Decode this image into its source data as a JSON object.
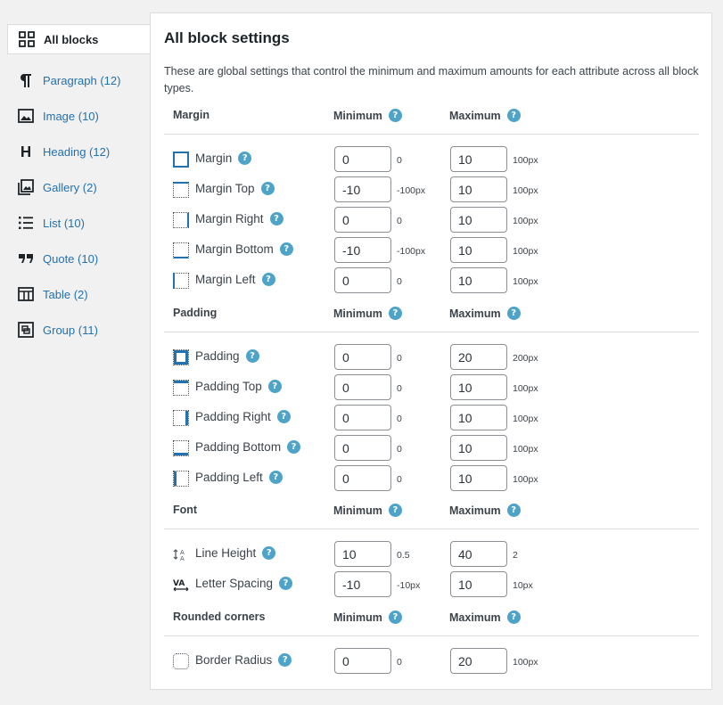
{
  "sidebar": {
    "items": [
      {
        "label": "All blocks",
        "icon": "grid-icon"
      },
      {
        "label": "Paragraph (12)",
        "icon": "paragraph-icon"
      },
      {
        "label": "Image (10)",
        "icon": "image-icon"
      },
      {
        "label": "Heading (12)",
        "icon": "heading-icon"
      },
      {
        "label": "Gallery (2)",
        "icon": "gallery-icon"
      },
      {
        "label": "List (10)",
        "icon": "list-icon"
      },
      {
        "label": "Quote (10)",
        "icon": "quote-icon"
      },
      {
        "label": "Table (2)",
        "icon": "table-icon"
      },
      {
        "label": "Group (11)",
        "icon": "group-icon"
      }
    ]
  },
  "panel": {
    "title": "All block settings",
    "description": "These are global settings that control the minimum and maximum amounts for each attribute across all block types.",
    "min_label": "Minimum",
    "max_label": "Maximum",
    "help_glyph": "?"
  },
  "sections": {
    "margin": {
      "label": "Margin",
      "rows": [
        {
          "label": "Margin",
          "min": "0",
          "min_hint": "0",
          "max": "10",
          "max_hint": "100px"
        },
        {
          "label": "Margin Top",
          "min": "-10",
          "min_hint": "-100px",
          "max": "10",
          "max_hint": "100px"
        },
        {
          "label": "Margin Right",
          "min": "0",
          "min_hint": "0",
          "max": "10",
          "max_hint": "100px"
        },
        {
          "label": "Margin Bottom",
          "min": "-10",
          "min_hint": "-100px",
          "max": "10",
          "max_hint": "100px"
        },
        {
          "label": "Margin Left",
          "min": "0",
          "min_hint": "0",
          "max": "10",
          "max_hint": "100px"
        }
      ]
    },
    "padding": {
      "label": "Padding",
      "rows": [
        {
          "label": "Padding",
          "min": "0",
          "min_hint": "0",
          "max": "20",
          "max_hint": "200px"
        },
        {
          "label": "Padding Top",
          "min": "0",
          "min_hint": "0",
          "max": "10",
          "max_hint": "100px"
        },
        {
          "label": "Padding Right",
          "min": "0",
          "min_hint": "0",
          "max": "10",
          "max_hint": "100px"
        },
        {
          "label": "Padding Bottom",
          "min": "0",
          "min_hint": "0",
          "max": "10",
          "max_hint": "100px"
        },
        {
          "label": "Padding Left",
          "min": "0",
          "min_hint": "0",
          "max": "10",
          "max_hint": "100px"
        }
      ]
    },
    "font": {
      "label": "Font",
      "rows": [
        {
          "label": "Line Height",
          "min": "10",
          "min_hint": "0.5",
          "max": "40",
          "max_hint": "2"
        },
        {
          "label": "Letter Spacing",
          "min": "-10",
          "min_hint": "-10px",
          "max": "10",
          "max_hint": "10px"
        }
      ]
    },
    "rounded": {
      "label": "Rounded corners",
      "rows": [
        {
          "label": "Border Radius",
          "min": "0",
          "min_hint": "0",
          "max": "20",
          "max_hint": "100px"
        }
      ]
    }
  },
  "colors": {
    "link": "#2271b1",
    "help": "#4ea3c8",
    "border": "#dcdcde"
  }
}
